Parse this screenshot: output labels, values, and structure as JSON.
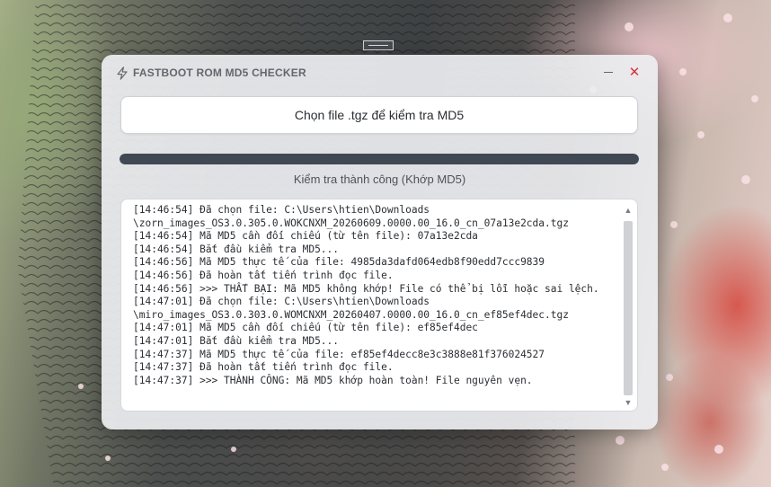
{
  "app": {
    "title": "FASTBOOT ROM MD5 CHECKER",
    "icon": "lightning-icon"
  },
  "window_controls": {
    "minimize": "—",
    "close": "✕"
  },
  "choose_button_label": "Chọn file .tgz để kiểm tra MD5",
  "progress": {
    "value_percent": 100
  },
  "status_text": "Kiểm tra thành công (Khớp MD5)",
  "log": [
    "[14:46:54] Đã chọn file: C:\\Users\\htien\\Downloads",
    "\\zorn_images_OS3.0.305.0.WOKCNXM_20260609.0000.00_16.0_cn_07a13e2cda.tgz",
    "[14:46:54] Mã MD5 cần đối chiếu (từ tên file): 07a13e2cda",
    "[14:46:54] Bắt đầu kiểm tra MD5...",
    "[14:46:56] Mã MD5 thực tế của file: 4985da3dafd064edb8f90edd7ccc9839",
    "[14:46:56] Đã hoàn tất tiến trình đọc file.",
    "[14:46:56] >>> THẤT BẠI: Mã MD5 không khớp! File có thể bị lỗi hoặc sai lệch.",
    "[14:47:01] Đã chọn file: C:\\Users\\htien\\Downloads",
    "\\miro_images_OS3.0.303.0.WOMCNXM_20260407.0000.00_16.0_cn_ef85ef4dec.tgz",
    "[14:47:01] Mã MD5 cần đối chiếu (từ tên file): ef85ef4dec",
    "[14:47:01] Bắt đầu kiểm tra MD5...",
    "[14:47:37] Mã MD5 thực tế của file: ef85ef4decc8e3c3888e81f376024527",
    "[14:47:37] Đã hoàn tất tiến trình đọc file.",
    "[14:47:37] >>> THÀNH CÔNG: Mã MD5 khớp hoàn toàn! File nguyên vẹn."
  ],
  "colors": {
    "close": "#d8333a",
    "progress": "#3f4853"
  }
}
